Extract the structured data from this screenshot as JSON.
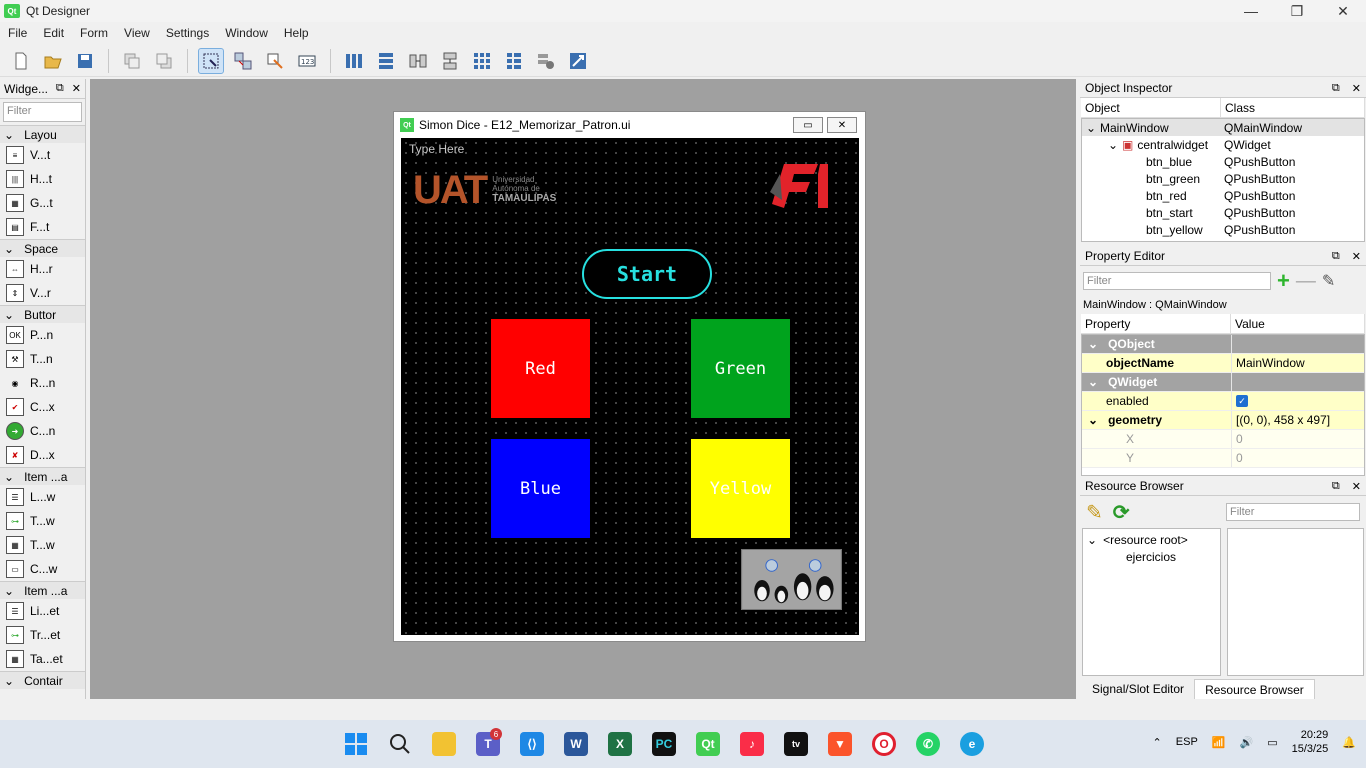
{
  "window": {
    "title": "Qt Designer",
    "logo": "Qt"
  },
  "menu": [
    "File",
    "Edit",
    "Form",
    "View",
    "Settings",
    "Window",
    "Help"
  ],
  "widget_box": {
    "title": "Widge...",
    "filter_placeholder": "Filter",
    "categories": [
      {
        "label": "Layou",
        "items": [
          "V...t",
          "H...t",
          "G...t",
          "F...t"
        ]
      },
      {
        "label": "Space",
        "items": [
          "H...r",
          "V...r"
        ]
      },
      {
        "label": "Buttor",
        "items": [
          "P...n",
          "T...n",
          "R...n",
          "C...x",
          "C...n",
          "D...x"
        ]
      },
      {
        "label": "Item ...a",
        "items": [
          "L...w",
          "T...w",
          "T...w",
          "C...w"
        ]
      },
      {
        "label": "Item ...a",
        "items": [
          "Li...et",
          "Tr...et",
          "Ta...et"
        ]
      },
      {
        "label": "Contair",
        "items": []
      }
    ]
  },
  "form": {
    "title": "Simon Dice - E12_Memorizar_Patron.ui",
    "type_here": "Type Here",
    "uat_text": "UAT",
    "uat_sub1": "Universidad",
    "uat_sub2": "Autónoma de",
    "uat_sub3": "TAMAULIPAS",
    "start_label": "Start",
    "red_label": "Red",
    "green_label": "Green",
    "blue_label": "Blue",
    "yellow_label": "Yellow"
  },
  "object_inspector": {
    "title": "Object Inspector",
    "col_object": "Object",
    "col_class": "Class",
    "rows": [
      {
        "object": "MainWindow",
        "class": "QMainWindow"
      },
      {
        "object": "centralwidget",
        "class": "QWidget"
      },
      {
        "object": "btn_blue",
        "class": "QPushButton"
      },
      {
        "object": "btn_green",
        "class": "QPushButton"
      },
      {
        "object": "btn_red",
        "class": "QPushButton"
      },
      {
        "object": "btn_start",
        "class": "QPushButton"
      },
      {
        "object": "btn_yellow",
        "class": "QPushButton"
      }
    ]
  },
  "property_editor": {
    "title": "Property Editor",
    "filter_placeholder": "Filter",
    "path": "MainWindow : QMainWindow",
    "col_property": "Property",
    "col_value": "Value",
    "rows": [
      {
        "property": "QObject",
        "value": ""
      },
      {
        "property": "objectName",
        "value": "MainWindow"
      },
      {
        "property": "QWidget",
        "value": ""
      },
      {
        "property": "enabled",
        "value": "✓"
      },
      {
        "property": "geometry",
        "value": "[(0, 0), 458 x 497]"
      },
      {
        "property": "X",
        "value": "0"
      },
      {
        "property": "Y",
        "value": "0"
      }
    ]
  },
  "resource_browser": {
    "title": "Resource Browser",
    "filter_placeholder": "Filter",
    "root": "<resource root>",
    "child": "ejercicios"
  },
  "bottom_tabs": [
    "Signal/Slot Editor",
    "Resource Browser"
  ],
  "taskbar": {
    "teams_badge": "6",
    "lang": "ESP",
    "time": "20:29",
    "date": "15/3/25"
  }
}
